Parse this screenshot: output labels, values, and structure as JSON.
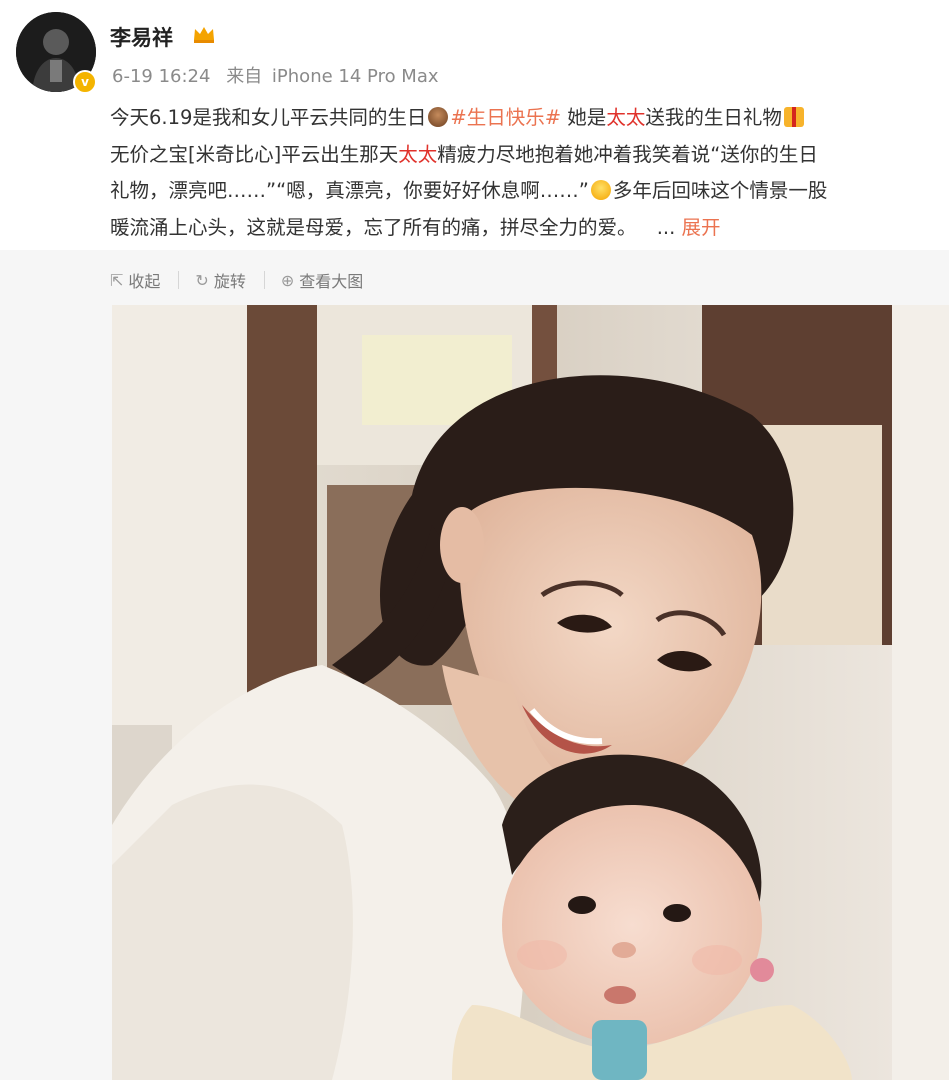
{
  "user": {
    "name": "李易祥",
    "verified_badge": "v-badge",
    "crown_icon": "crown-icon"
  },
  "meta": {
    "date": "6-19 16:24",
    "source_prefix": "来自",
    "device": "iPhone 14 Pro Max"
  },
  "post": {
    "l1_a": "今天6.19是我和女儿平云共同的生日",
    "l1_tag": "#生日快乐#",
    "l1_b": " 她是",
    "l1_red": "太太",
    "l1_c": "送我的生日礼物",
    "l2_a": "无价之宝[米奇比心]平云出生那天",
    "l2_red": "太太",
    "l2_b": "精疲力尽地抱着她冲着我笑着说“送你的生日",
    "l3_a": "礼物，漂亮吧……”“嗯，真漂亮，你要好好休息啊……”",
    "l3_b": "多年后回味这个情景一股",
    "l4_a": "暖流涌上心头，这就是母爱，忘了所有的痛，拼尽全力的爱。",
    "l4_more_dots": "...",
    "l4_expand": "展开"
  },
  "actions": {
    "collapse": "收起",
    "repost": "旋转",
    "view_large": "查看大图"
  },
  "colors": {
    "tag": "#eb7350",
    "highlight": "#e0322b",
    "meta": "#8a8a8a"
  }
}
